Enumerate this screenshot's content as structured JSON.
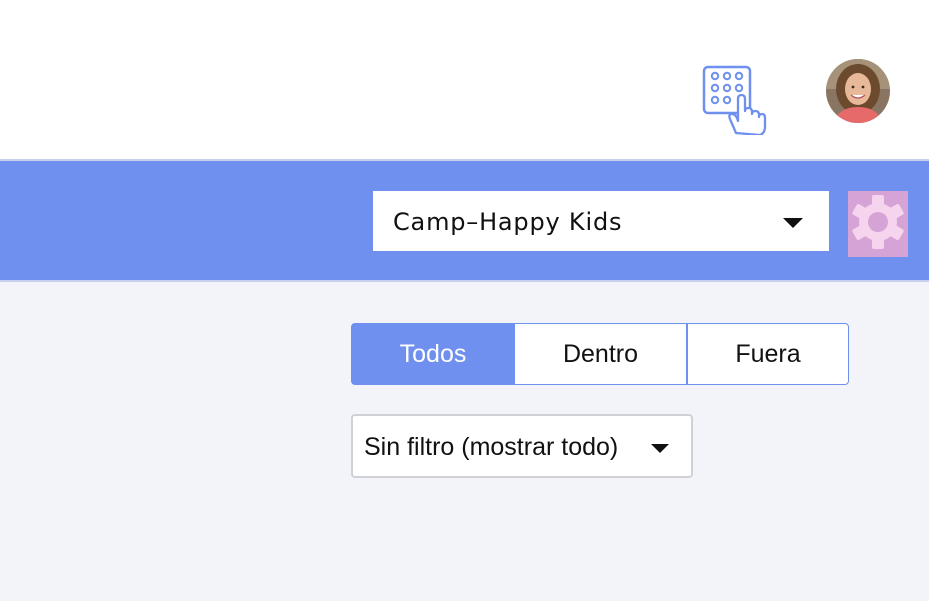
{
  "header": {
    "keypad_icon": "keypad-touch-icon",
    "avatar": "user-avatar"
  },
  "location_bar": {
    "camp_select": {
      "value": "Camp–Happy Kids"
    },
    "settings_icon": "gear-icon"
  },
  "tabs": [
    {
      "label": "Todos",
      "active": true
    },
    {
      "label": "Dentro",
      "active": false
    },
    {
      "label": "Fuera",
      "active": false
    }
  ],
  "filter": {
    "value": "Sin filtro (mostrar todo)"
  },
  "colors": {
    "accent": "#6f90ee",
    "background": "#f3f4f9",
    "gear_bg": "#d5a3d6"
  }
}
